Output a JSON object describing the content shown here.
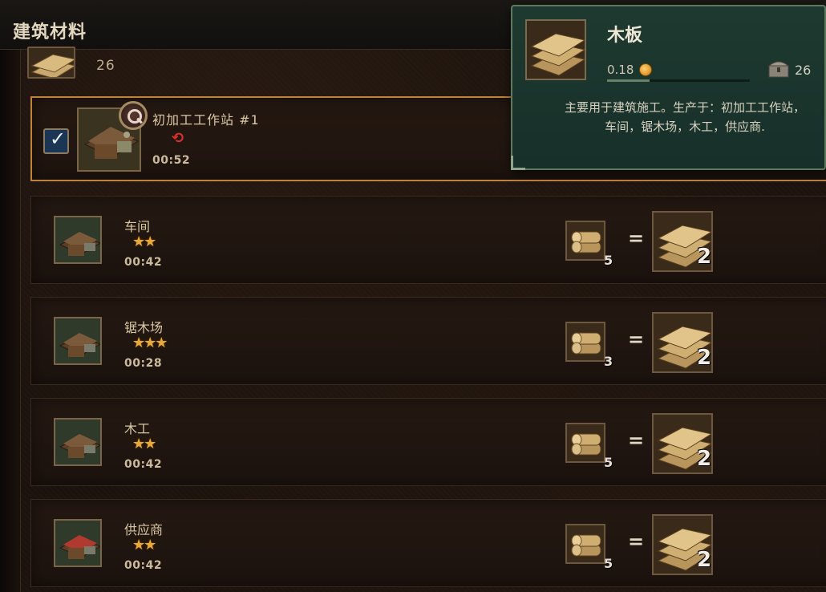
{
  "header": {
    "title": "建筑材料"
  },
  "top_row": {
    "count": "26",
    "item_icon": "planks-icon"
  },
  "active_station": {
    "name": "初加工工作站 #1",
    "time": "00:52",
    "checked": true,
    "status_icon": "red-swirl-icon",
    "inspect_icon": "magnifier-icon"
  },
  "recipes": [
    {
      "name": "车间",
      "stars": "★★",
      "time": "00:42",
      "input_icon": "logs-icon",
      "input_qty": "5",
      "output_icon": "planks-icon",
      "output_qty": "2"
    },
    {
      "name": "锯木场",
      "stars": "★★★",
      "time": "00:28",
      "input_icon": "logs-icon",
      "input_qty": "3",
      "output_icon": "planks-icon",
      "output_qty": "2"
    },
    {
      "name": "木工",
      "stars": "★★",
      "time": "00:42",
      "input_icon": "logs-icon",
      "input_qty": "5",
      "output_icon": "planks-icon",
      "output_qty": "2"
    },
    {
      "name": "供应商",
      "stars": "★★",
      "time": "00:42",
      "input_icon": "logs-icon",
      "input_qty": "5",
      "output_icon": "planks-icon",
      "output_qty": "2"
    }
  ],
  "equals_sign": "=",
  "tooltip": {
    "title": "木板",
    "price": "0.18",
    "price_icon": "coin-icon",
    "price_bar_fraction": 0.3,
    "stock": "26",
    "stock_icon": "chest-icon",
    "description": "主要用于建筑施工。生产于：初加工工作站，车间，锯木场，木工，供应商."
  },
  "colors": {
    "star": "#e7a93a",
    "active_border": "#c0823a",
    "tooltip_bg": "#1e3a30",
    "checkbox_bg": "#1b3654"
  }
}
